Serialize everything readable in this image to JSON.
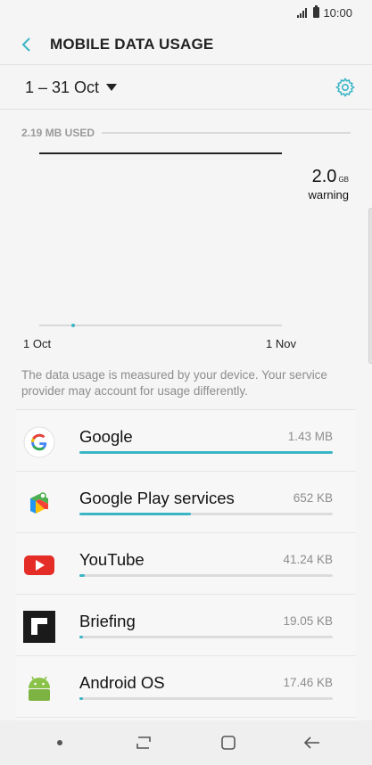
{
  "status_bar": {
    "time": "10:00"
  },
  "header": {
    "title": "MOBILE DATA USAGE"
  },
  "period": {
    "label": "1 – 31 Oct"
  },
  "usage": {
    "used_label": "2.19 MB USED"
  },
  "chart_data": {
    "type": "line",
    "x_start_label": "1 Oct",
    "x_end_label": "1 Nov",
    "warning_value": "2.0",
    "warning_unit": "GB",
    "warning_label": "warning"
  },
  "disclaimer": "The data usage is measured by your device. Your service provider may account for usage differently.",
  "apps": [
    {
      "name": "Google",
      "size": "1.43 MB",
      "usage_fraction": 1.0,
      "icon": "google-icon"
    },
    {
      "name": "Google Play services",
      "size": "652 KB",
      "usage_fraction": 0.44,
      "icon": "play-services-icon"
    },
    {
      "name": "YouTube",
      "size": "41.24 KB",
      "usage_fraction": 0.02,
      "icon": "youtube-icon"
    },
    {
      "name": "Briefing",
      "size": "19.05 KB",
      "usage_fraction": 0.01,
      "icon": "briefing-icon"
    },
    {
      "name": "Android OS",
      "size": "17.46 KB",
      "usage_fraction": 0.01,
      "icon": "android-icon"
    }
  ],
  "colors": {
    "accent": "#3ab5c6",
    "background": "#f5f5f5"
  }
}
